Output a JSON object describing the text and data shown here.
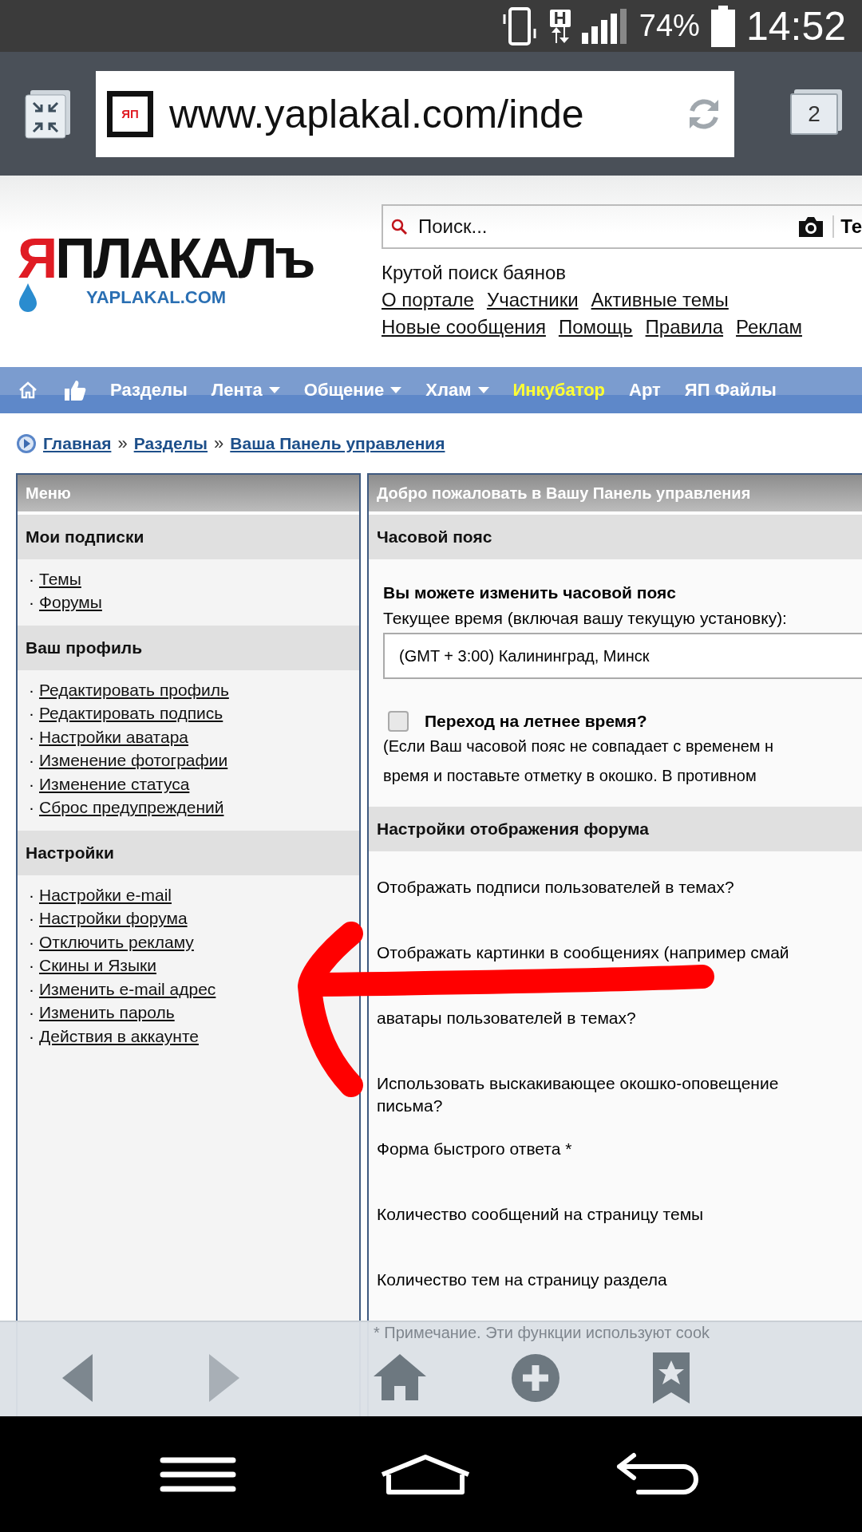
{
  "status_bar": {
    "network": "H",
    "battery": "74%",
    "time": "14:52"
  },
  "browser": {
    "favicon": "ЯП",
    "url": "www.yaplakal.com/inde",
    "tab_count": "2"
  },
  "header": {
    "logo": {
      "accent": "Я",
      "text": "ПЛАКАЛъ",
      "domain": "YAPLAKAL.COM"
    },
    "search": {
      "placeholder": "Поиск...",
      "button": "Те"
    },
    "tagline": "Крутой поиск баянов",
    "link_rows": [
      [
        "О портале",
        "Участники",
        "Активные темы"
      ],
      [
        "Новые сообщения",
        "Помощь",
        "Правила",
        "Реклам"
      ]
    ]
  },
  "nav": {
    "items": [
      {
        "label": "Разделы",
        "dropdown": false,
        "highlighted": false
      },
      {
        "label": "Лента",
        "dropdown": true,
        "highlighted": false
      },
      {
        "label": "Общение",
        "dropdown": true,
        "highlighted": false
      },
      {
        "label": "Хлам",
        "dropdown": true,
        "highlighted": false
      },
      {
        "label": "Инкубатор",
        "dropdown": false,
        "highlighted": true
      },
      {
        "label": "Арт",
        "dropdown": false,
        "highlighted": false
      },
      {
        "label": "ЯП Файлы",
        "dropdown": false,
        "highlighted": false
      }
    ]
  },
  "breadcrumb": {
    "separator": "»",
    "items": [
      "Главная",
      "Разделы",
      "Ваша Панель управления"
    ]
  },
  "menu": {
    "title": "Меню",
    "bullet": "·",
    "sections": [
      {
        "title": "Мои подписки",
        "items": [
          "Темы",
          "Форумы"
        ]
      },
      {
        "title": "Ваш профиль",
        "items": [
          "Редактировать профиль",
          "Редактировать подпись",
          "Настройки аватара",
          "Изменение фотографии",
          "Изменение статуса",
          "Сброс предупреждений"
        ]
      },
      {
        "title": "Настройки",
        "items": [
          "Настройки e-mail",
          "Настройки форума",
          "Отключить рекламу",
          "Скины и Языки",
          "Изменить e-mail адрес",
          "Изменить пароль",
          "Действия в аккаунте"
        ]
      }
    ]
  },
  "panel": {
    "title": "Добро пожаловать в Вашу Панель управления",
    "timezone": {
      "title": "Часовой пояс",
      "heading": "Вы можете изменить часовой пояс",
      "current_label": "Текущее время (включая вашу текущую установку):",
      "select_value": "(GMT + 3:00) Калининград, Минск",
      "dst": {
        "label": "Переход на летнее время?",
        "checked": false
      },
      "note_lines": [
        "(Если Ваш часовой пояс не совпадает с временем н",
        "время и поставьте отметку в окошко. В противном"
      ]
    },
    "display": {
      "title": "Настройки отображения форума",
      "rows": [
        [
          "Отображать подписи пользователей в темах?"
        ],
        [
          "Отображать картинки в сообщениях (например смай"
        ],
        [
          "аватары пользователей в темах?"
        ],
        [
          "Использовать выскакивающее окошко-оповещение",
          "письма?"
        ],
        [
          "Форма быстрого ответа *"
        ],
        [
          "Количество сообщений на страницу темы"
        ],
        [
          "Количество тем на страницу раздела"
        ]
      ]
    },
    "footnote": "* Примечание. Эти функции используют cook"
  },
  "toolbar": [
    {
      "kind": "back",
      "disabled": false
    },
    {
      "kind": "forward",
      "disabled": true
    },
    {
      "kind": "home",
      "disabled": false
    },
    {
      "kind": "add",
      "disabled": false
    },
    {
      "kind": "bookmark",
      "disabled": false
    }
  ],
  "system_nav": [
    {
      "kind": "menu"
    },
    {
      "kind": "home"
    },
    {
      "kind": "back"
    }
  ]
}
